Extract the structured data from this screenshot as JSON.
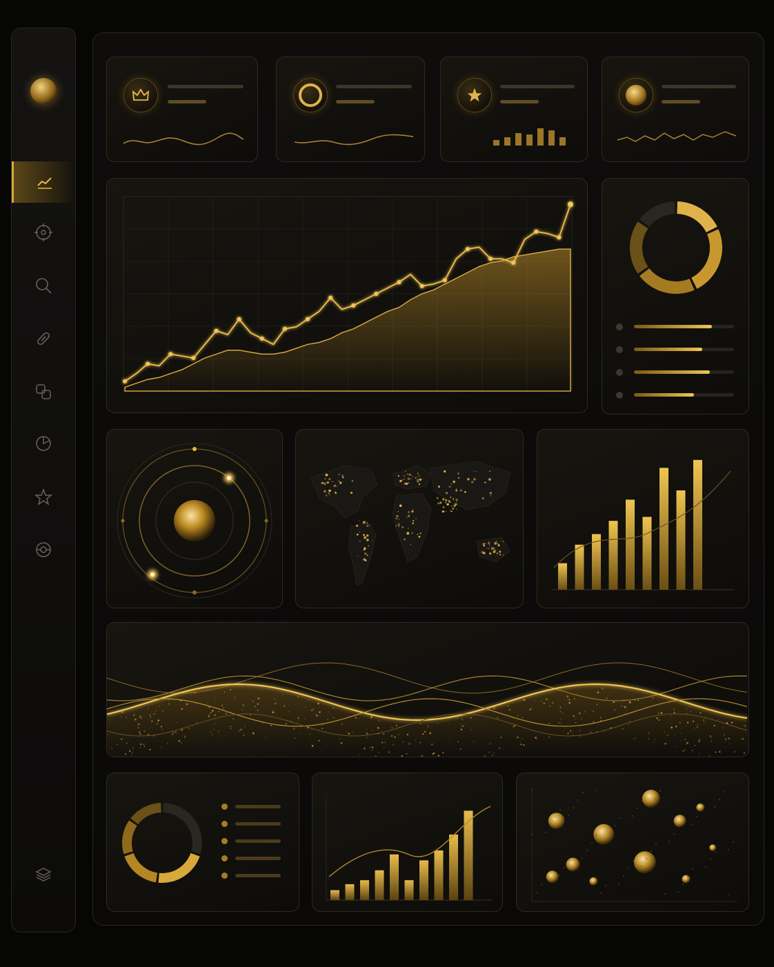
{
  "theme": {
    "accent": "#d9a93a",
    "background": "#060605",
    "card": "#15130f"
  },
  "sidebar": {
    "logo": "gold-orb-logo",
    "items": [
      {
        "icon": "line-chart-icon",
        "active": true
      },
      {
        "icon": "target-icon",
        "active": false
      },
      {
        "icon": "search-icon",
        "active": false
      },
      {
        "icon": "link-icon",
        "active": false
      },
      {
        "icon": "layers-icon",
        "active": false
      },
      {
        "icon": "pie-chart-icon",
        "active": false
      },
      {
        "icon": "star-icon",
        "active": false
      },
      {
        "icon": "settings-icon",
        "active": false
      }
    ],
    "footer_icon": "stack-icon"
  },
  "kpis": [
    {
      "icon": "crown-icon",
      "spark": "line"
    },
    {
      "icon": "ring-icon",
      "spark": "line"
    },
    {
      "icon": "star-icon",
      "spark": "bars"
    },
    {
      "icon": "orb-icon",
      "spark": "line"
    }
  ],
  "chart_data": [
    {
      "type": "line",
      "series": [
        {
          "values": [
            5,
            9,
            14,
            13,
            19,
            18,
            17,
            24,
            31,
            29,
            37,
            30,
            27,
            24,
            32,
            33,
            37,
            41,
            48,
            42,
            44,
            47,
            50,
            53,
            56,
            60,
            54,
            55,
            57,
            68,
            73,
            74,
            68,
            68,
            66,
            78,
            82,
            81,
            79,
            96
          ]
        },
        {
          "values": [
            2,
            4,
            6,
            7,
            9,
            11,
            14,
            17,
            19,
            21,
            21,
            20,
            19,
            19,
            20,
            22,
            24,
            25,
            27,
            30,
            32,
            35,
            38,
            41,
            43,
            47,
            50,
            52,
            55,
            58,
            61,
            64,
            66,
            67,
            69,
            70,
            71,
            72,
            73,
            73
          ]
        }
      ]
    },
    {
      "type": "pie",
      "values": [
        18,
        25,
        22,
        20,
        15
      ]
    },
    {
      "type": "bar",
      "values": [
        20,
        34,
        42,
        52,
        68,
        55,
        92,
        75,
        98
      ]
    },
    {
      "type": "pie",
      "values": [
        30,
        22,
        18,
        15,
        15
      ]
    },
    {
      "type": "bar",
      "values": [
        10,
        16,
        20,
        30,
        46,
        20,
        40,
        50,
        66,
        90
      ]
    },
    {
      "type": "scatter",
      "points": [
        {
          "x": 12,
          "y": 72,
          "r": 12
        },
        {
          "x": 10,
          "y": 22,
          "r": 9
        },
        {
          "x": 20,
          "y": 33,
          "r": 10
        },
        {
          "x": 35,
          "y": 60,
          "r": 15
        },
        {
          "x": 30,
          "y": 18,
          "r": 6
        },
        {
          "x": 58,
          "y": 92,
          "r": 13
        },
        {
          "x": 55,
          "y": 35,
          "r": 16
        },
        {
          "x": 72,
          "y": 72,
          "r": 9
        },
        {
          "x": 75,
          "y": 20,
          "r": 6
        },
        {
          "x": 82,
          "y": 84,
          "r": 6
        },
        {
          "x": 88,
          "y": 48,
          "r": 5
        }
      ]
    }
  ],
  "legend": [
    {
      "fill": 0.78
    },
    {
      "fill": 0.68
    },
    {
      "fill": 0.76
    },
    {
      "fill": 0.6
    }
  ]
}
